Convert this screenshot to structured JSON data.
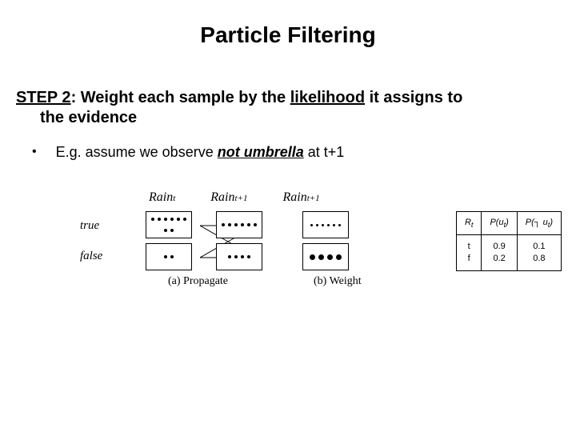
{
  "title": "Particle Filtering",
  "step": {
    "label": "STEP 2",
    "text_before_likelihood": ": Weight each sample by the ",
    "likelihood_word": "likelihood",
    "text_after_likelihood": " it assigns to",
    "line2": "the evidence"
  },
  "bullet": {
    "prefix": "E.g. assume we observe ",
    "keyword": "not umbrella",
    "suffix": "  at t+1"
  },
  "diagram": {
    "vars": {
      "rain": "Rain",
      "sub_t": "t",
      "sub_t1": "t+1"
    },
    "row_true": "true",
    "row_false": "false",
    "caption_a": "(a) Propagate",
    "caption_b": "(b) Weight"
  },
  "table": {
    "head": {
      "c1": "R",
      "c1_sub": "t",
      "c2": "P(u",
      "c2_sub": "t",
      "c2_close": ")",
      "c3_pre": "P(",
      "c3_neg": "┐",
      "c3_mid": "u",
      "c3_sub": "t",
      "c3_close": ")"
    },
    "rows": [
      {
        "r": "t\nf",
        "p_u": "0.9\n0.2",
        "p_nu": "0.1\n0.8"
      }
    ]
  },
  "chart_data": {
    "type": "table",
    "title": "Observation model P(u_t | R_t)",
    "columns": [
      "R_t",
      "P(u_t)",
      "P(¬u_t)"
    ],
    "rows": [
      {
        "R_t": "t",
        "P(u_t)": 0.9,
        "P(¬u_t)": 0.1
      },
      {
        "R_t": "f",
        "P(u_t)": 0.2,
        "P(¬u_t)": 0.8
      }
    ]
  }
}
